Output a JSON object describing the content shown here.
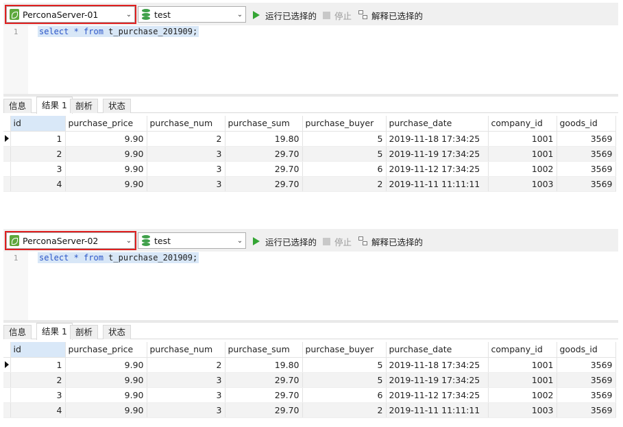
{
  "toolbar": {
    "run_label": "运行已选择的",
    "stop_label": "停止",
    "explain_label": "解释已选择的",
    "database": "test"
  },
  "editor": {
    "line_number": "1",
    "sql": {
      "kw_select": "select",
      "star": " * ",
      "kw_from": "from",
      "table": " t_purchase_201909;"
    }
  },
  "tabs": [
    "信息",
    "结果 1",
    "剖析",
    "状态"
  ],
  "columns": [
    "id",
    "purchase_price",
    "purchase_num",
    "purchase_sum",
    "purchase_buyer",
    "purchase_date",
    "company_id",
    "goods_id"
  ],
  "rows": [
    [
      "1",
      "9.90",
      "2",
      "19.80",
      "5",
      "2019-11-18 17:34:25",
      "1001",
      "3569"
    ],
    [
      "2",
      "9.90",
      "3",
      "29.70",
      "5",
      "2019-11-19 17:34:25",
      "1001",
      "3569"
    ],
    [
      "3",
      "9.90",
      "3",
      "29.70",
      "6",
      "2019-11-12 17:34:25",
      "1002",
      "3569"
    ],
    [
      "4",
      "9.90",
      "3",
      "29.70",
      "2",
      "2019-11-11 11:11:11",
      "1003",
      "3569"
    ]
  ],
  "panels": [
    {
      "connection": "PerconaServer-01"
    },
    {
      "connection": "PerconaServer-02"
    }
  ],
  "colors": {
    "highlight_box": "#e02020",
    "run_green": "#34a534",
    "selection": "#d8e7f7"
  }
}
